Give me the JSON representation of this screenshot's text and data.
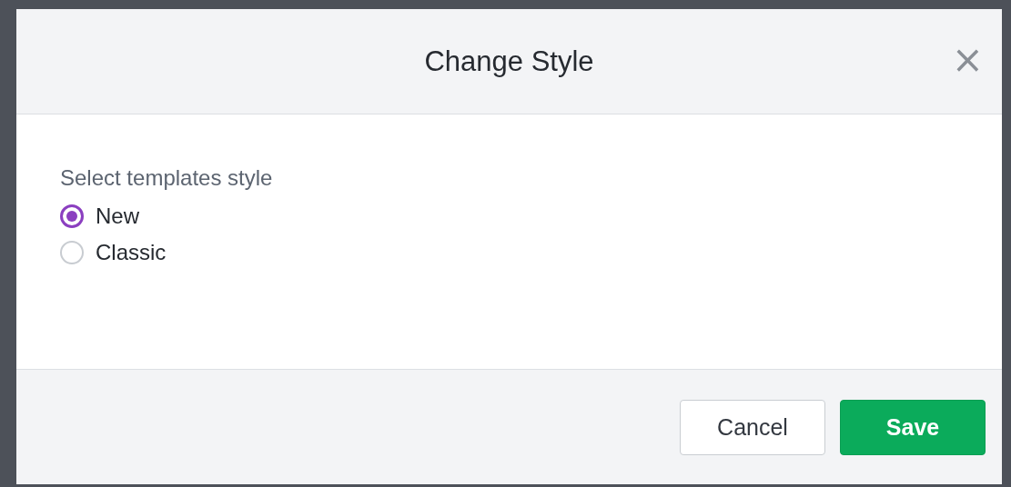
{
  "dialog": {
    "title": "Change Style",
    "close": "×"
  },
  "group": {
    "label": "Select templates style",
    "options": [
      {
        "label": "New",
        "selected": true
      },
      {
        "label": "Classic",
        "selected": false
      }
    ]
  },
  "buttons": [
    {
      "label": "Cancel",
      "kind": "secondary"
    },
    {
      "label": "Save",
      "kind": "primary"
    }
  ]
}
